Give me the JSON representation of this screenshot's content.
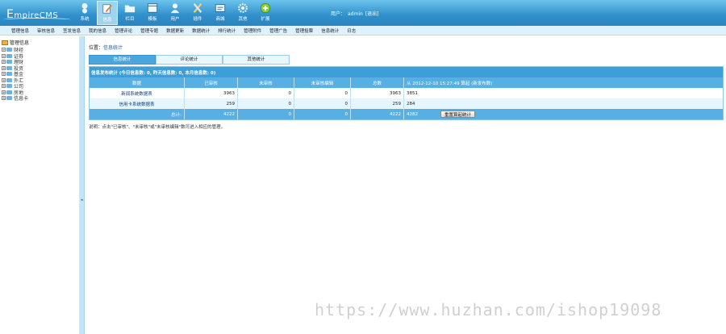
{
  "brand": {
    "logo_text_big": "E",
    "logo_text_rest": "mpireCMS"
  },
  "nav": [
    {
      "label": "系统",
      "icon": "system-icon"
    },
    {
      "label": "信息",
      "icon": "info-icon",
      "active": true
    },
    {
      "label": "栏目",
      "icon": "folder-icon"
    },
    {
      "label": "模板",
      "icon": "template-icon"
    },
    {
      "label": "用户",
      "icon": "user-icon"
    },
    {
      "label": "插件",
      "icon": "plugin-icon"
    },
    {
      "label": "商城",
      "icon": "shop-icon"
    },
    {
      "label": "其他",
      "icon": "gear-icon"
    },
    {
      "label": "扩展",
      "icon": "add-icon"
    }
  ],
  "user": {
    "prefix": "用户：",
    "name": "admin",
    "logout": "[退出]"
  },
  "subnav": [
    "管理信息",
    "审核信息",
    "签发信息",
    "我的信息",
    "管理评论",
    "管理专题",
    "数据更新",
    "数据统计",
    "排行统计",
    "管理附件",
    "管理广告",
    "管理投票",
    "信息统计",
    "日志"
  ],
  "sidebar": {
    "root": "管理信息",
    "items": [
      "财经",
      "证券",
      "理财",
      "投资",
      "基金",
      "外汇",
      "公司",
      "房地",
      "信息卡"
    ]
  },
  "breadcrumb": {
    "prefix": "位置：",
    "link": "信息统计"
  },
  "tabs": [
    {
      "label": "信息统计",
      "active": true
    },
    {
      "label": "评论统计",
      "active": false
    },
    {
      "label": "其他统计",
      "active": false
    }
  ],
  "table": {
    "caption": "信息发布统计 (今日信息数: 0, 昨天信息数: 0, 本月信息数: 0)",
    "headers": [
      "数据",
      "已审核",
      "未审核",
      "未审核编辑",
      "总数",
      "从 2012-12-10 15:27:49 算起 (新发布数)"
    ],
    "rows": [
      {
        "name": "新闻系统数据表",
        "approved": "3963",
        "unapproved": "0",
        "unapproved_edit": "0",
        "total": "3963",
        "since": "3851"
      },
      {
        "name": "信用卡系统数据表",
        "approved": "259",
        "unapproved": "0",
        "unapproved_edit": "0",
        "total": "259",
        "since": "284"
      }
    ],
    "total": {
      "label": "总计:",
      "approved": "4222",
      "unapproved": "0",
      "unapproved_edit": "0",
      "total": "4222",
      "since": "4282",
      "reset_button": "重置算起统计"
    }
  },
  "note": "说明：点击\"已审核\"、\"未审核\"或\"未审核编辑\"数可进入相应的管理。",
  "watermark": "https://www.huzhan.com/ishop19098"
}
